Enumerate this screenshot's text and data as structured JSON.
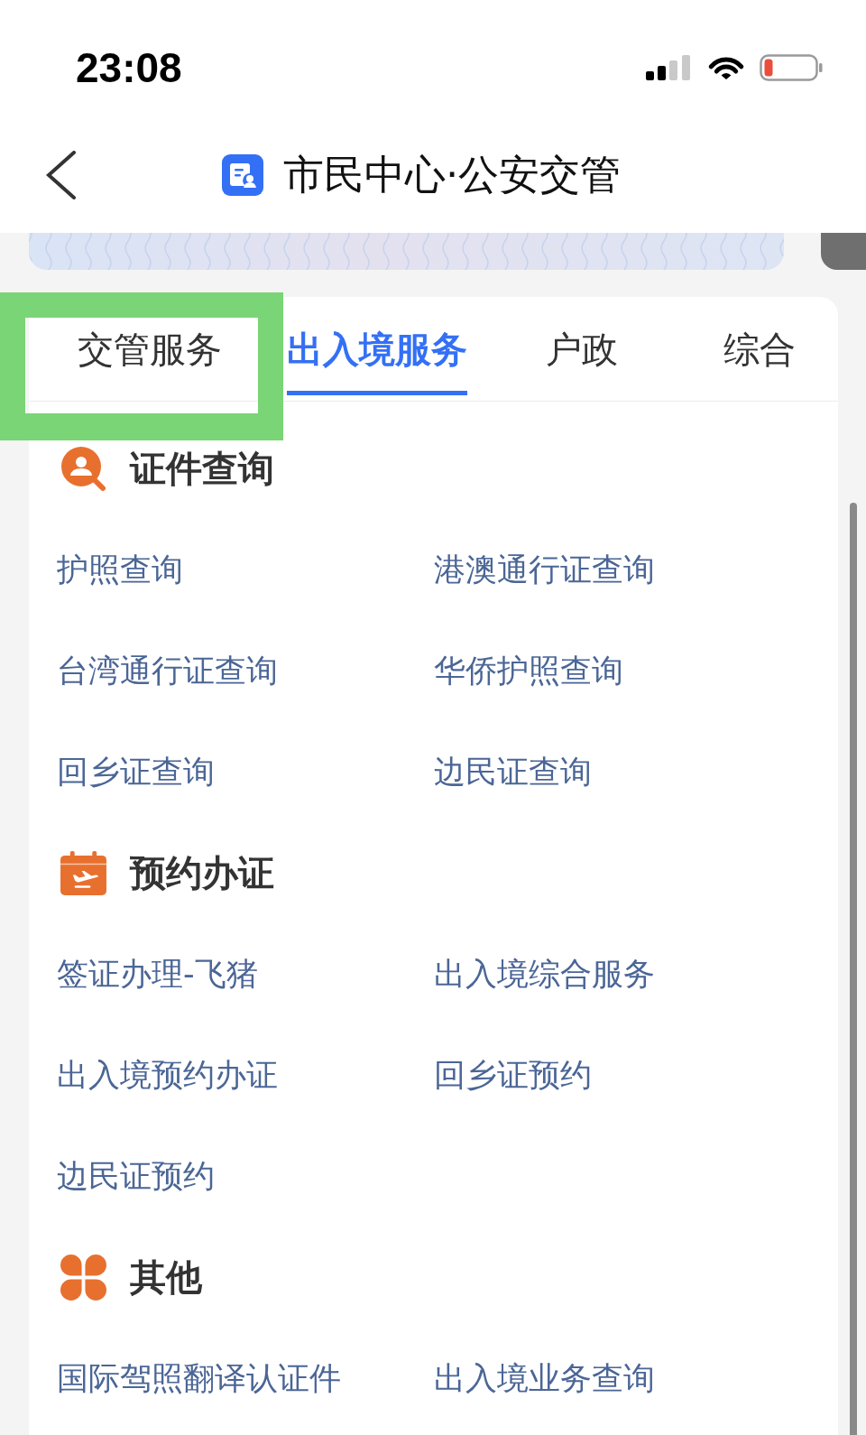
{
  "status_bar": {
    "time": "23:08"
  },
  "header": {
    "title": "市民中心·公安交管"
  },
  "tabs": [
    {
      "label": "交管服务",
      "selected": false
    },
    {
      "label": "出入境服务",
      "selected": true
    },
    {
      "label": "户政",
      "selected": false
    },
    {
      "label": "综合",
      "selected": false
    }
  ],
  "sections": [
    {
      "title": "证件查询",
      "items": [
        "护照查询",
        "港澳通行证查询",
        "台湾通行证查询",
        "华侨护照查询",
        "回乡证查询",
        "边民证查询"
      ]
    },
    {
      "title": "预约办证",
      "items": [
        "签证办理-飞猪",
        "出入境综合服务",
        "出入境预约办证",
        "回乡证预约",
        "边民证预约"
      ]
    },
    {
      "title": "其他",
      "items": [
        "国际驾照翻译认证件",
        "出入境业务查询"
      ]
    }
  ]
}
